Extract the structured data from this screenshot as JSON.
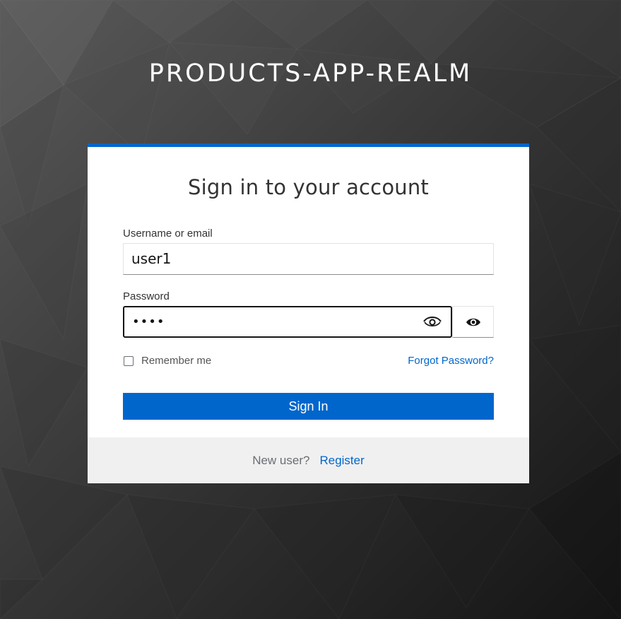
{
  "realm": {
    "title": "PRODUCTS-APP-REALM"
  },
  "login": {
    "heading": "Sign in to your account",
    "username_label": "Username or email",
    "username_value": "user1",
    "password_label": "Password",
    "password_value": "••••",
    "remember_label": "Remember me",
    "forgot_label": "Forgot Password?",
    "signin_label": "Sign In",
    "remember_checked": false
  },
  "footer": {
    "new_user_text": "New user?",
    "register_label": "Register"
  },
  "colors": {
    "accent": "#0066cc",
    "background": "#3a3a3a",
    "footer_bg": "#f0f0f0"
  },
  "icons": [
    "show-password-icon",
    "eye-icon"
  ]
}
